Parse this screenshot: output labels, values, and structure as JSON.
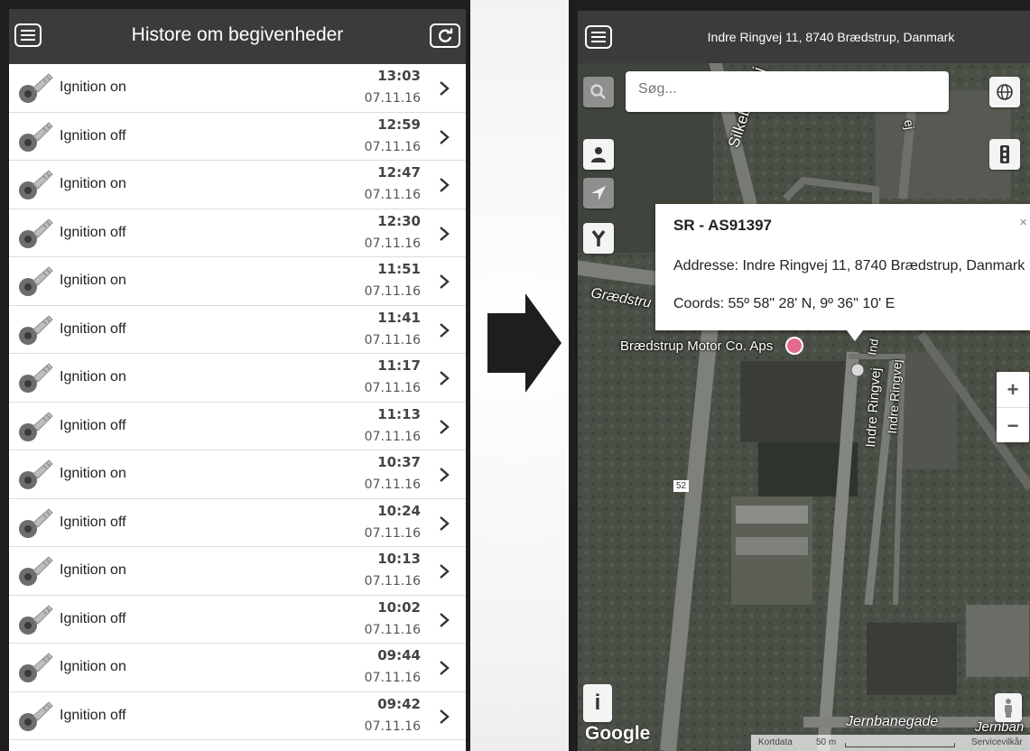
{
  "left_screen": {
    "title": "Histore om begivenheder",
    "events": [
      {
        "label": "Ignition on",
        "time": "13:03",
        "date": "07.11.16"
      },
      {
        "label": "Ignition off",
        "time": "12:59",
        "date": "07.11.16"
      },
      {
        "label": "Ignition on",
        "time": "12:47",
        "date": "07.11.16"
      },
      {
        "label": "Ignition off",
        "time": "12:30",
        "date": "07.11.16"
      },
      {
        "label": "Ignition on",
        "time": "11:51",
        "date": "07.11.16"
      },
      {
        "label": "Ignition off",
        "time": "11:41",
        "date": "07.11.16"
      },
      {
        "label": "Ignition on",
        "time": "11:17",
        "date": "07.11.16"
      },
      {
        "label": "Ignition off",
        "time": "11:13",
        "date": "07.11.16"
      },
      {
        "label": "Ignition on",
        "time": "10:37",
        "date": "07.11.16"
      },
      {
        "label": "Ignition off",
        "time": "10:24",
        "date": "07.11.16"
      },
      {
        "label": "Ignition on",
        "time": "10:13",
        "date": "07.11.16"
      },
      {
        "label": "Ignition off",
        "time": "10:02",
        "date": "07.11.16"
      },
      {
        "label": "Ignition on",
        "time": "09:44",
        "date": "07.11.16"
      },
      {
        "label": "Ignition off",
        "time": "09:42",
        "date": "07.11.16"
      }
    ],
    "icons": {
      "menu": "menu-icon",
      "refresh": "refresh-icon",
      "row": "key-icon",
      "chevron": "chevron-right-icon"
    }
  },
  "right_screen": {
    "header_address": "Indre Ringvej 11, 8740 Brædstrup, Danmark",
    "search_placeholder": "Søg...",
    "popup": {
      "title": "SR - AS91397",
      "close": "×",
      "address": "Addresse: Indre Ringvej 11, 8740 Brædstrup, Danmark",
      "coords": "Coords: 55º 58\" 28' N, 9º 36\" 10' E"
    },
    "map_labels": {
      "silkeborgvej": "Silkeborgvej",
      "graedstrup": "Grædstru",
      "business": "Brædstrup Motor Co. Aps",
      "indre1": "Indre Ringvej",
      "indre2": "Indre Ringvej",
      "indre_top": "Ind",
      "ej": "ej",
      "road52": "52",
      "jernbanegade": "Jernbanegade",
      "jernban": "Jernban",
      "google": "Google",
      "kortdata": "Kortdata",
      "scale": "50 m",
      "servicevilkar": "Servicevilkår"
    },
    "zoom_in": "+",
    "zoom_out": "−",
    "info": "i",
    "icons": [
      "menu-icon",
      "search-icon",
      "person-icon",
      "navigate-icon",
      "route-fork-icon",
      "globe-icon",
      "traffic-light-icon",
      "info-icon",
      "street-view-icon",
      "shopping-bag-icon"
    ]
  },
  "colors": {
    "header_bg": "#3b3b3b",
    "map_bg": "#4a4f46",
    "arrow": "#1e1e1e"
  }
}
